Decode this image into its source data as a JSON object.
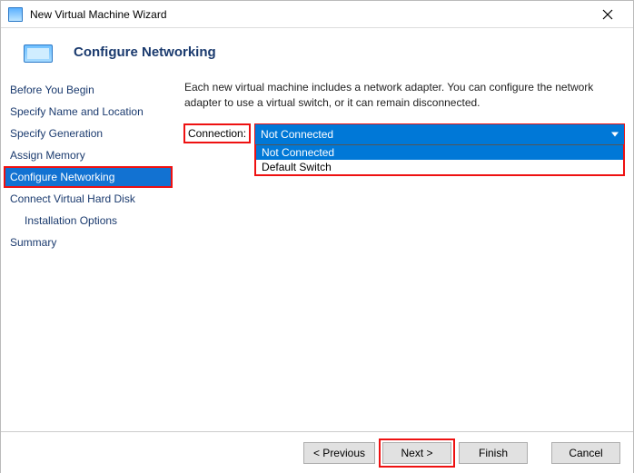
{
  "window": {
    "title": "New Virtual Machine Wizard"
  },
  "header": {
    "title": "Configure Networking"
  },
  "sidebar": {
    "items": [
      {
        "label": "Before You Begin"
      },
      {
        "label": "Specify Name and Location"
      },
      {
        "label": "Specify Generation"
      },
      {
        "label": "Assign Memory"
      },
      {
        "label": "Configure Networking",
        "active": true,
        "highlight": true
      },
      {
        "label": "Connect Virtual Hard Disk"
      },
      {
        "label": "Installation Options",
        "indent": true
      },
      {
        "label": "Summary"
      }
    ]
  },
  "main": {
    "intro": "Each new virtual machine includes a network adapter. You can configure the network adapter to use a virtual switch, or it can remain disconnected.",
    "connection_label": "Connection:",
    "connection_value": "Not Connected",
    "connection_options": [
      {
        "label": "Not Connected",
        "selected": true
      },
      {
        "label": "Default Switch",
        "selected": false
      }
    ]
  },
  "footer": {
    "previous": "< Previous",
    "next": "Next >",
    "finish": "Finish",
    "cancel": "Cancel"
  }
}
